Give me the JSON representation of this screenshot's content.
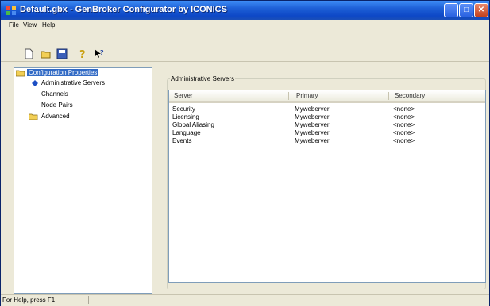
{
  "window": {
    "title": "Default.gbx - GenBroker Configurator by ICONICS"
  },
  "menu": {
    "items": [
      "File",
      "View",
      "Help"
    ]
  },
  "toolbar": {
    "icons": [
      "new-icon",
      "open-icon",
      "save-icon",
      "help-icon",
      "context-help-icon"
    ]
  },
  "tree": {
    "root": "Configuration Properties",
    "children": [
      {
        "label": "Administrative Servers"
      },
      {
        "label": "Channels"
      },
      {
        "label": "Node Pairs"
      }
    ],
    "advanced": "Advanced"
  },
  "panel": {
    "group_label": "Administrative Servers",
    "columns": [
      "Server",
      "Primary",
      "Secondary"
    ],
    "rows": [
      {
        "server": "Security",
        "primary": "Myweberver",
        "secondary": "<none>"
      },
      {
        "server": "Licensing",
        "primary": "Myweberver",
        "secondary": "<none>"
      },
      {
        "server": "Global Aliasing",
        "primary": "Myweberver",
        "secondary": "<none>"
      },
      {
        "server": "Language",
        "primary": "Myweberver",
        "secondary": "<none>"
      },
      {
        "server": "Events",
        "primary": "Myweberver",
        "secondary": "<none>"
      }
    ]
  },
  "status": {
    "text": "For Help, press F1"
  },
  "colors": {
    "title_bar": "#0d47c6",
    "selection": "#316ac5",
    "background": "#ece9d8"
  }
}
